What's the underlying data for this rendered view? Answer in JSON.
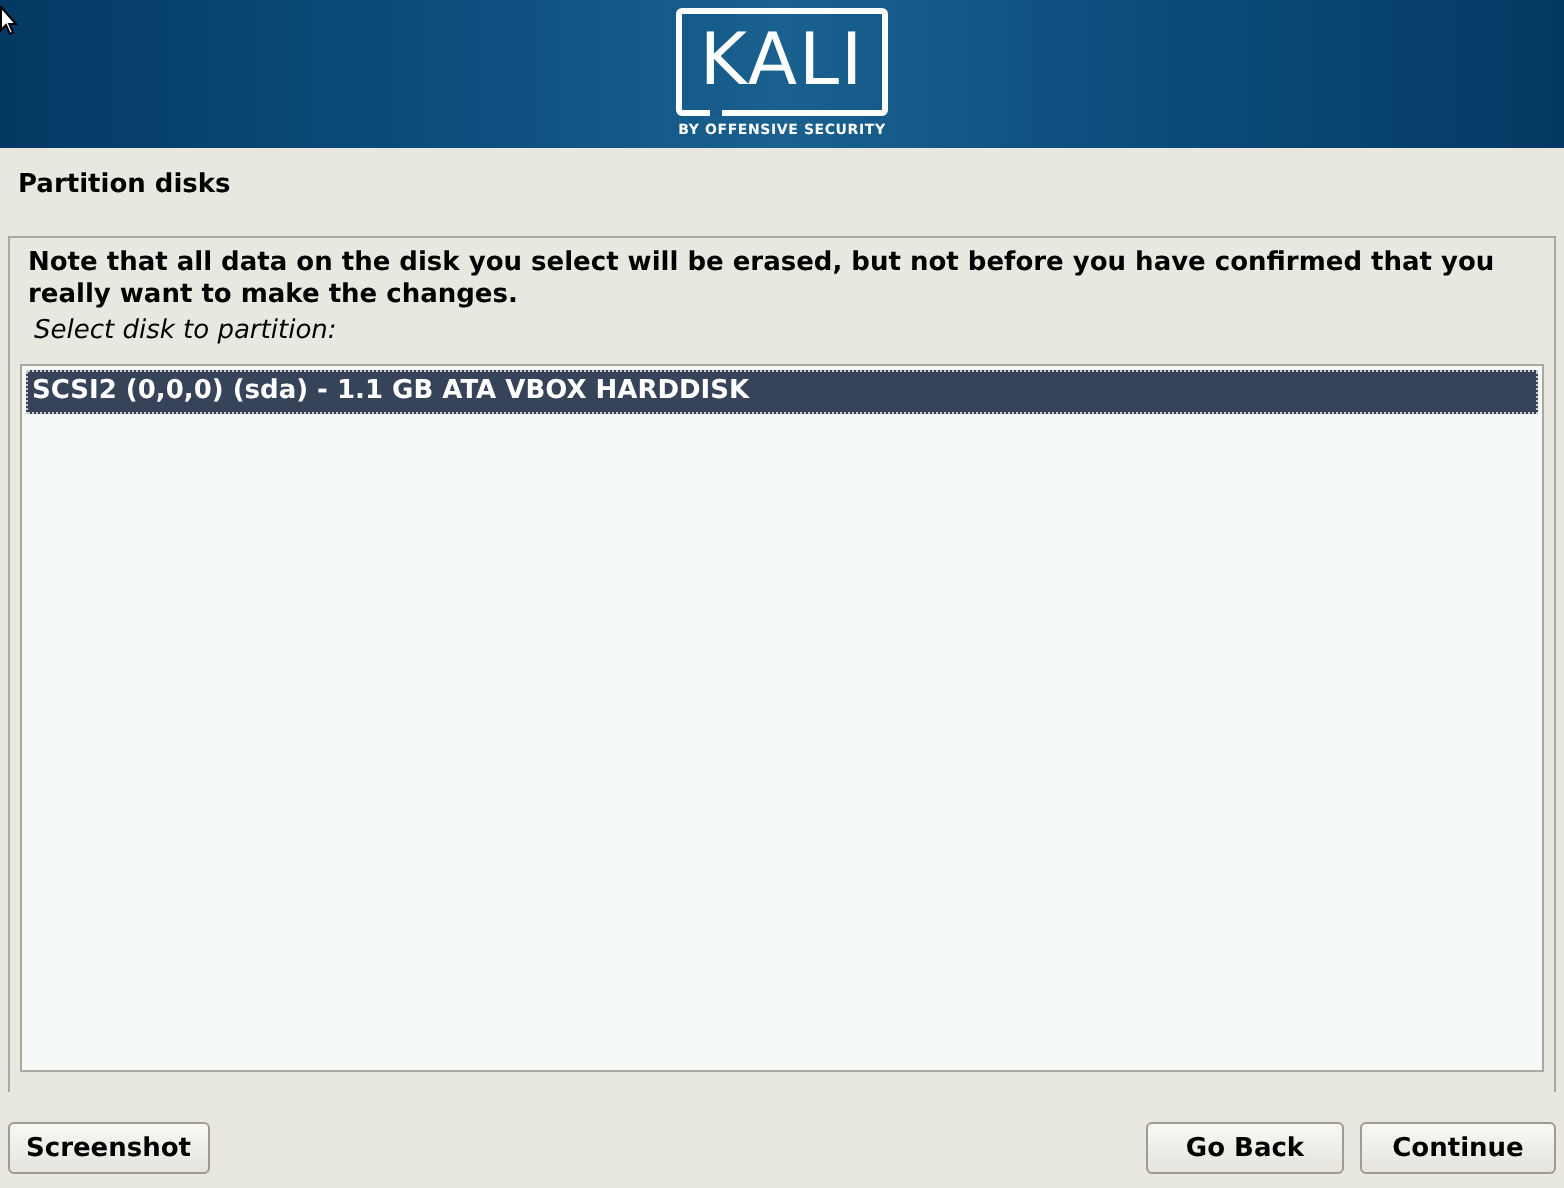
{
  "banner": {
    "logo": "KALI",
    "tagline": "BY OFFENSIVE SECURITY"
  },
  "title": "Partition disks",
  "note": "Note that all data on the disk you select will be erased, but not before you have confirmed that you really want to make the changes.",
  "prompt": "Select disk to partition:",
  "disks": [
    {
      "label": "SCSI2 (0,0,0) (sda) - 1.1 GB ATA VBOX HARDDISK",
      "selected": true
    }
  ],
  "buttons": {
    "left": [
      "Screenshot"
    ],
    "right": [
      "Go Back",
      "Continue"
    ]
  }
}
